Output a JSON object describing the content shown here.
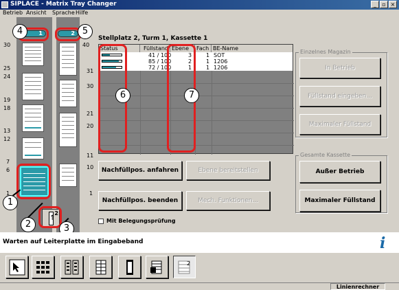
{
  "window": {
    "title": "SIPLACE - Matrix Tray Changer",
    "controls": {
      "minimize": "_",
      "maximize": "▫",
      "close": "×"
    }
  },
  "menu": [
    "Betrieb",
    "Ansicht",
    "Sprache",
    "Hilfe"
  ],
  "towers": {
    "tower1_label": "1",
    "tower2_label": "2",
    "scale_left": [
      "30",
      "25",
      "24",
      "19",
      "18",
      "13",
      "12",
      "7",
      "6",
      "1"
    ],
    "scale_mid": [
      "40",
      "31",
      "30",
      "21",
      "20",
      "11",
      "10",
      "1"
    ],
    "lift_level": "2"
  },
  "callouts": [
    "1",
    "2",
    "3",
    "4",
    "5",
    "6",
    "7"
  ],
  "location": {
    "title": "Stellplatz 2, Turm 1, Kassette 1"
  },
  "table": {
    "headers": [
      "Status",
      "Füllstand",
      "Ebene",
      "Fach",
      "BE-Name"
    ],
    "rows": [
      {
        "fill_level": "41 / 100",
        "fill_fraction": 0.41,
        "level": "3",
        "slot": "1",
        "name": "SOT"
      },
      {
        "fill_level": "85 / 100",
        "fill_fraction": 0.85,
        "level": "2",
        "slot": "1",
        "name": "1206"
      },
      {
        "fill_level": "72 / 100",
        "fill_fraction": 0.72,
        "level": "1",
        "slot": "1",
        "name": "1206"
      }
    ]
  },
  "buttons": {
    "refill_start": "Nachfüllpos. anfahren",
    "provide_level": "Ebene bereitstellen",
    "refill_end": "Nachfüllpos. beenden",
    "mech_functions": "Mech. Funktionen...",
    "occupancy_check": "Mit Belegungsprüfung"
  },
  "single_magazine": {
    "legend": "Einzelnes Magazin",
    "in_operation": "In Betrieb",
    "enter_fill": "Füllstand eingeben...",
    "max_fill": "Maximaler Füllstand"
  },
  "whole_cassette": {
    "legend": "Gesamte Kassette",
    "out_of_operation": "Außer Betrieb",
    "max_fill": "Maximaler Füllstand"
  },
  "message": "Warten auf Leiterplatte im Eingabeband",
  "statusbar": {
    "mode": "Linienrechner"
  },
  "colors": {
    "accent": "#2a9aa8",
    "callout_red": "#e02020",
    "title_bar": "#0a246a"
  }
}
